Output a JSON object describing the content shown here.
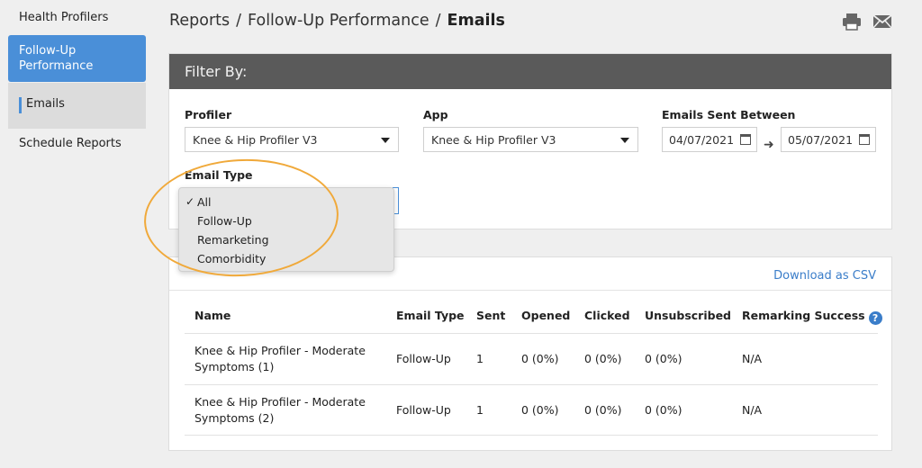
{
  "sidebar": {
    "items": [
      {
        "label": "Health Profilers"
      },
      {
        "label": "Follow-Up Performance"
      },
      {
        "label": "Emails"
      },
      {
        "label": "Schedule Reports"
      }
    ]
  },
  "breadcrumb": {
    "items": [
      "Reports",
      "Follow-Up Performance",
      "Emails"
    ],
    "separator": "/"
  },
  "header_icons": [
    "print-icon",
    "mail-icon"
  ],
  "filter": {
    "title": "Filter By:",
    "profiler": {
      "label": "Profiler",
      "value": "Knee & Hip Profiler V3"
    },
    "app": {
      "label": "App",
      "value": "Knee & Hip Profiler V3"
    },
    "dates": {
      "label": "Emails Sent Between",
      "start": "04/07/2021",
      "end": "05/07/2021"
    },
    "email_type": {
      "label": "Email Type",
      "options": [
        "All",
        "Follow-Up",
        "Remarketing",
        "Comorbidity"
      ],
      "selected": "All"
    }
  },
  "results": {
    "download_label": "Download as CSV",
    "columns": [
      "Name",
      "Email Type",
      "Sent",
      "Opened",
      "Clicked",
      "Unsubscribed",
      "Remarking Success"
    ],
    "rows": [
      {
        "name": "Knee & Hip Profiler - Moderate Symptoms (1)",
        "type": "Follow-Up",
        "sent": "1",
        "opened": "0 (0%)",
        "clicked": "0 (0%)",
        "unsub": "0 (0%)",
        "success": "N/A"
      },
      {
        "name": "Knee & Hip Profiler - Moderate Symptoms (2)",
        "type": "Follow-Up",
        "sent": "1",
        "opened": "0 (0%)",
        "clicked": "0 (0%)",
        "unsub": "0 (0%)",
        "success": "N/A"
      }
    ]
  },
  "colors": {
    "accent": "#4a8fd8",
    "highlight": "#f0a93a",
    "link": "#3a7dc9"
  }
}
